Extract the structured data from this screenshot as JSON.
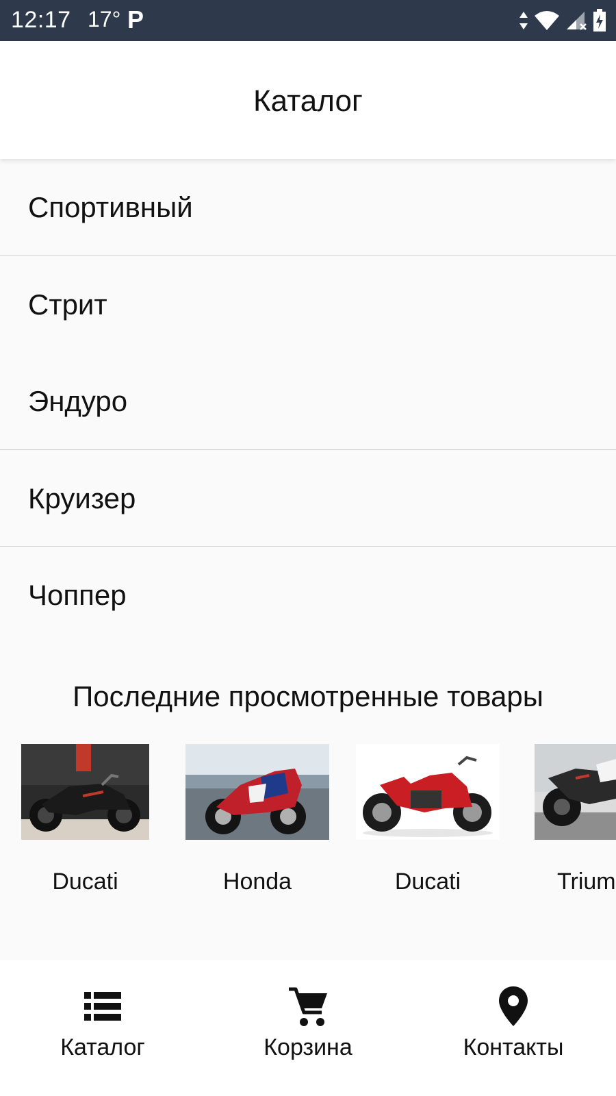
{
  "status_bar": {
    "time": "12:17",
    "temp": "17°",
    "p_icon": "P"
  },
  "app_bar": {
    "title": "Каталог"
  },
  "categories": [
    {
      "label": "Спортивный"
    },
    {
      "label": "Стрит"
    },
    {
      "label": "Эндуро"
    },
    {
      "label": "Круизер"
    },
    {
      "label": "Чоппер"
    }
  ],
  "recent": {
    "title": "Последние просмотренные товары",
    "items": [
      {
        "name": "Ducati",
        "image": "motorcycle-black-cruiser"
      },
      {
        "name": "Honda",
        "image": "motorcycle-red-sport"
      },
      {
        "name": "Ducati",
        "image": "motorcycle-red-naked"
      },
      {
        "name": "Trium",
        "image": "motorcycle-street"
      }
    ]
  },
  "bottom_nav": [
    {
      "label": "Каталог",
      "icon": "list-icon"
    },
    {
      "label": "Корзина",
      "icon": "cart-icon"
    },
    {
      "label": "Контакты",
      "icon": "location-pin-icon"
    }
  ],
  "colors": {
    "status_bar": "#2e3a4c",
    "background": "#fafafa",
    "divider": "#d0d0d0"
  }
}
